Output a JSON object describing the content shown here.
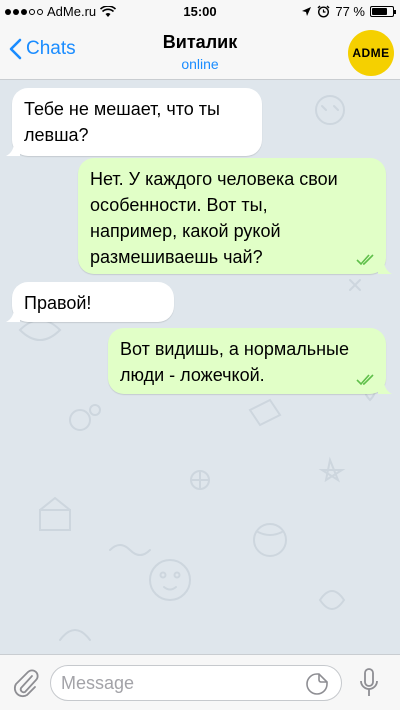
{
  "status_bar": {
    "carrier": "AdMe.ru",
    "time": "15:00",
    "battery_text": "77 %",
    "battery_level": 0.77,
    "icons": [
      "signal-dots-icon",
      "wifi-icon",
      "location-arrow-icon",
      "alarm-icon",
      "battery-icon"
    ]
  },
  "nav": {
    "back_label": "Chats",
    "title": "Виталик",
    "subtitle": "online",
    "avatar_text": "ADME",
    "accent_color": "#1a8cff",
    "avatar_color": "#f5d000"
  },
  "messages": [
    {
      "direction": "in",
      "lines": [
        "Тебе не мешает, что ты",
        "левша?"
      ]
    },
    {
      "direction": "out",
      "lines": [
        "Нет. У каждого человека свои",
        "особенности. Вот ты,",
        "например, какой рукой",
        "размешиваешь чай?"
      ],
      "read": true
    },
    {
      "direction": "in",
      "lines": [
        "Правой!"
      ]
    },
    {
      "direction": "out",
      "lines": [
        "Вот видишь, а нормальные",
        "люди - ложечкой."
      ],
      "read": true
    }
  ],
  "colors": {
    "incoming_bubble": "#ffffff",
    "outgoing_bubble": "#e1ffc7",
    "read_ticks": "#5fbf4a",
    "chat_background": "#dfe6ec"
  },
  "input": {
    "placeholder": "Message",
    "value": "",
    "icons": [
      "paperclip-icon",
      "sticker-icon",
      "microphone-icon"
    ]
  }
}
